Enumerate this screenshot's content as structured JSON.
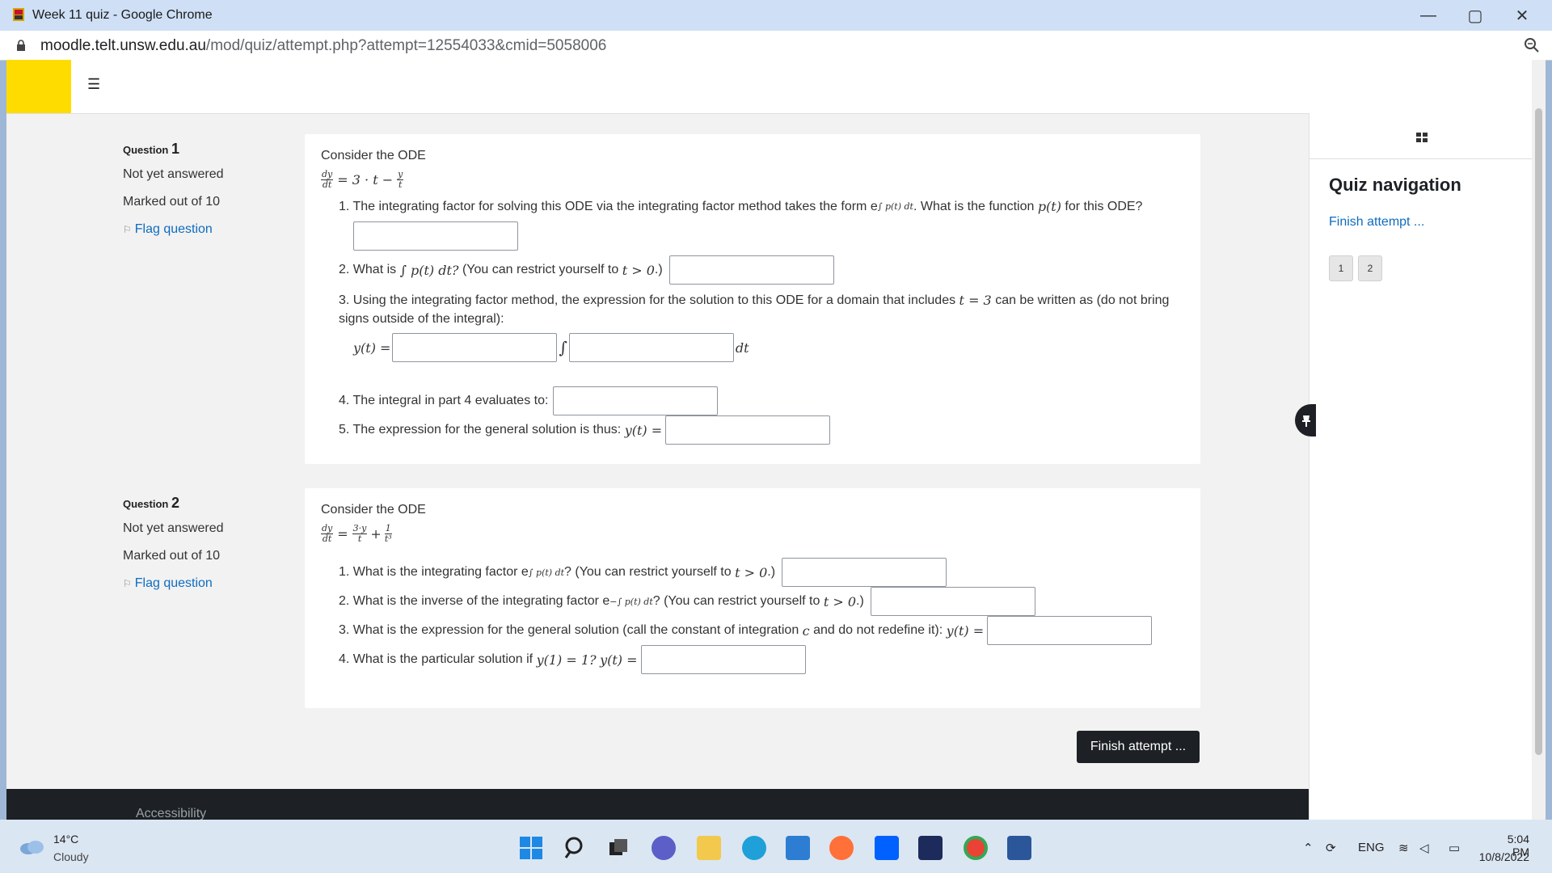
{
  "window": {
    "title": "Week 11 quiz - Google Chrome"
  },
  "address": {
    "host": "moodle.telt.unsw.edu.au",
    "path": "/mod/quiz/attempt.php?attempt=12554033&cmid=5058006"
  },
  "questions": [
    {
      "label": "Question",
      "number": "1",
      "state": "Not yet answered",
      "marks": "Marked out of 10",
      "flag": "Flag question",
      "intro": "Consider the ODE",
      "ode": "= 3 · t −",
      "items": [
        {
          "text": "1. The integrating factor for solving this ODE via the integrating factor method takes the form e",
          "sup": "∫ p(t) dt",
          "text2": ". What is the function",
          "math": "p(t)",
          "text3": "for this ODE?"
        },
        {
          "text": "2. What is",
          "math": "∫ p(t) dt?",
          "text2": "(You can restrict yourself to",
          "math2": "t > 0",
          "text3": ".)"
        },
        {
          "text": "3. Using the integrating factor method, the expression for the solution to this ODE for a domain that includes",
          "math": "t = 3",
          "text2": "can be written as (do not bring",
          "line2": "signs outside of the integral):",
          "lhs": "y(t) =",
          "integral": "∫",
          "dt": "dt"
        },
        {
          "text": "4. The integral in part 4 evaluates to:"
        },
        {
          "text": "5. The expression for the general solution is thus:",
          "math": "y(t) ="
        }
      ]
    },
    {
      "label": "Question",
      "number": "2",
      "state": "Not yet answered",
      "marks": "Marked out of 10",
      "flag": "Flag question",
      "intro": "Consider the ODE",
      "ode": "=",
      "items": [
        {
          "text": "1. What is the integrating factor e",
          "sup": "∫ p(t) dt",
          "text2": "? (You can restrict yourself to",
          "math": "t > 0",
          "text3": ".)"
        },
        {
          "text": "2. What is the inverse of the integrating factor e",
          "sup": "−∫ p(t) dt",
          "text2": "? (You can restrict yourself to",
          "math": "t > 0",
          "text3": ".)"
        },
        {
          "text": "3. What is the expression for the general solution (call the constant of integration",
          "math": "c",
          "text2": "and do not redefine it):",
          "math2": "y(t) ="
        },
        {
          "text": "4. What is the particular solution if",
          "math": "y(1) = 1?",
          "math2": "y(t) ="
        }
      ]
    }
  ],
  "nav": {
    "title": "Quiz navigation",
    "finish_link": "Finish attempt ...",
    "buttons": [
      "1",
      "2"
    ]
  },
  "finish_button": "Finish attempt ...",
  "footer": {
    "accessibility": "Accessibility"
  },
  "taskbar": {
    "weather_temp": "14°C",
    "weather_cond": "Cloudy",
    "lang": "ENG",
    "time": "5:04 PM",
    "date": "10/8/2022"
  },
  "colors": {
    "brand_yellow": "#ffdc00",
    "link": "#0f6cbf",
    "dark": "#1d2125"
  }
}
